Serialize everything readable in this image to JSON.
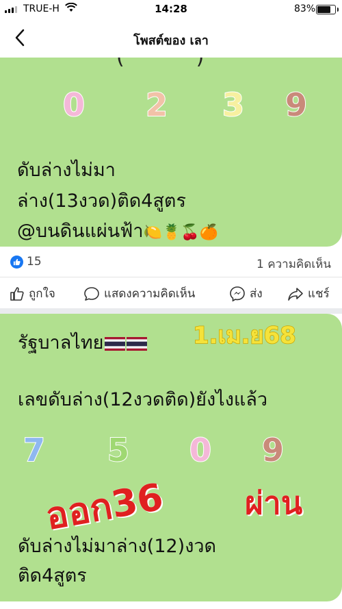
{
  "status": {
    "carrier": "TRUE-H",
    "time": "14:28",
    "battery": "83%",
    "battery_level": 0.83
  },
  "nav": {
    "title": "โพสต์ของ เลา"
  },
  "post1": {
    "numbers": [
      "0",
      "2",
      "3",
      "9"
    ],
    "line1": "ดับล่างไม่มา",
    "line2": "ล่าง(13งวด)ติด4สูตร",
    "line3": "@บนดินแผ่นฟ้า",
    "emojis": "🍋🍍🍒🍊",
    "likes": "15",
    "comments": "1 ความคิดเห็น"
  },
  "actions": {
    "like": "ถูกใจ",
    "comment": "แสดงความคิดเห็น",
    "send": "ส่ง",
    "share": "แชร์"
  },
  "post2": {
    "heading": "รัฐบาลไทย",
    "date": "1.เม.ย68",
    "line1": "เลขดับล่าง(12งวดติด)ยังไงแล้ว",
    "numbers": [
      "7",
      "5",
      "0",
      "9"
    ],
    "stamp1": "ออก36",
    "stamp2": "ผ่าน",
    "line2": "ดับล่างไม่มาล่าง(12)งวด",
    "line3": "ติด4สูตร"
  },
  "colors": {
    "card_green": "#b1e08f",
    "num1": [
      "#f4b8d8",
      "#f2c2a8",
      "#f7f0a0",
      "#c98a7a"
    ],
    "num2": [
      "#8fb8f0",
      "#9fd872",
      "#f4b8d8",
      "#c98a7a"
    ],
    "facebook_blue": "#1877f2"
  }
}
